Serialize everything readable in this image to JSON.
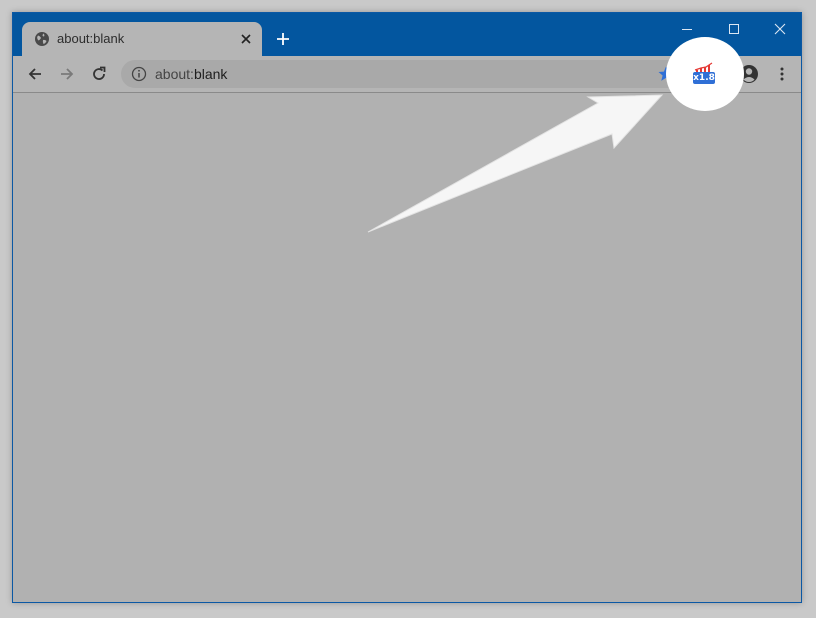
{
  "tab": {
    "title": "about:blank",
    "icon": "globe-icon",
    "close_icon": "close-icon"
  },
  "new_tab_icon": "plus-icon",
  "window_controls": [
    "minimize-icon",
    "maximize-icon",
    "close-icon"
  ],
  "toolbar": {
    "back_icon": "arrow-left-icon",
    "forward_icon": "arrow-right-icon",
    "reload_icon": "reload-icon",
    "menu_icon": "kebab-menu-icon",
    "profile_icon": "account-circle-icon"
  },
  "omnibox": {
    "prefix": "about:",
    "host": "blank",
    "info_icon": "info-icon",
    "bookmark_icon": "star-icon"
  },
  "extension": {
    "badge": "x1.8",
    "icon": "speed-chart-icon"
  },
  "colors": {
    "titlebar": "#03569f",
    "spotlight": "#ffffff",
    "accent": "#2f6fd6"
  }
}
